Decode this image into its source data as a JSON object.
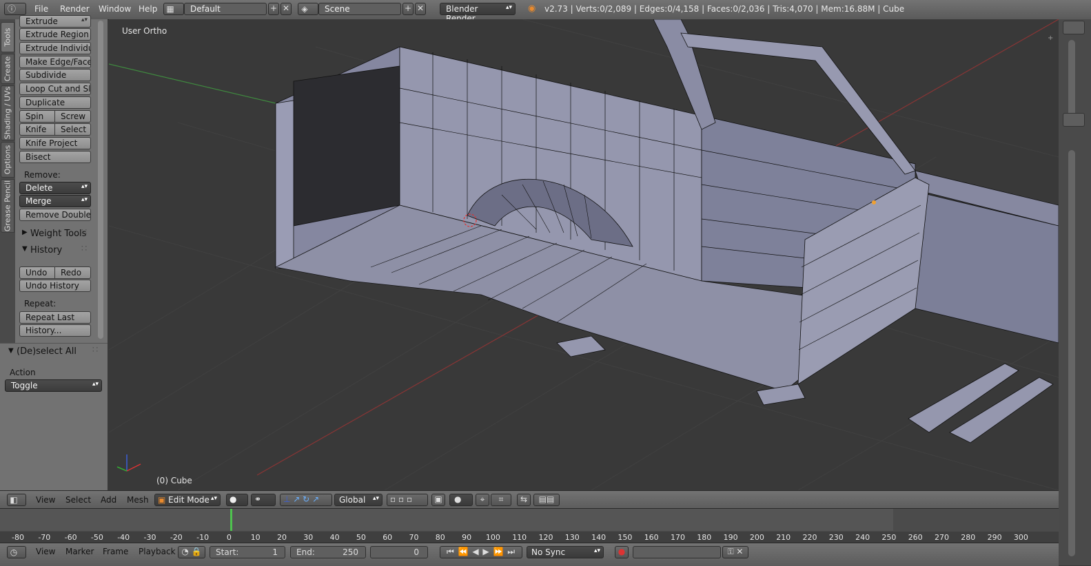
{
  "info_header": {
    "menus": [
      "File",
      "Render",
      "Window",
      "Help"
    ],
    "layout_name": "Default",
    "scene_name": "Scene",
    "render_engine": "Blender Render",
    "stats": "v2.73 | Verts:0/2,089 | Edges:0/4,158 | Faces:0/2,036 | Tris:4,070 | Mem:16.88M | Cube"
  },
  "tabs": [
    "Tools",
    "Create",
    "Shading / UVs",
    "Options",
    "Grease Pencil"
  ],
  "toolshelf": {
    "top_dropdown": "Extrude",
    "buttons": [
      "Extrude Region",
      "Extrude Individual",
      "Make Edge/Face",
      "Subdivide",
      "Loop Cut and Slide",
      "Duplicate"
    ],
    "spin": "Spin",
    "screw": "Screw",
    "knife": "Knife",
    "select": "Select",
    "knife_project": "Knife Project",
    "bisect": "Bisect",
    "remove_label": "Remove:",
    "delete": "Delete",
    "merge": "Merge",
    "remove_doubles": "Remove Doubles",
    "weight_tools": "Weight Tools",
    "history_title": "History",
    "undo": "Undo",
    "redo": "Redo",
    "undo_history": "Undo History",
    "repeat_label": "Repeat:",
    "repeat_last": "Repeat Last",
    "history_btn": "History..."
  },
  "operator": {
    "title": "(De)select All",
    "action_label": "Action",
    "action_value": "Toggle"
  },
  "viewport": {
    "view_name": "User Ortho",
    "object_label": "(0) Cube",
    "bg_color": "#393939",
    "mesh_color": "#8e90a6"
  },
  "view_header": {
    "menus": [
      "View",
      "Select",
      "Add",
      "Mesh"
    ],
    "mode": "Edit Mode",
    "orientation": "Global"
  },
  "timeline": {
    "ticks": [
      "-80",
      "-70",
      "-60",
      "-50",
      "-40",
      "-30",
      "-20",
      "-10",
      "0",
      "10",
      "20",
      "30",
      "40",
      "50",
      "60",
      "70",
      "80",
      "90",
      "100",
      "110",
      "120",
      "130",
      "140",
      "150",
      "160",
      "170",
      "180",
      "190",
      "200",
      "210",
      "220",
      "230",
      "240",
      "250",
      "260",
      "270",
      "280",
      "290",
      "300"
    ],
    "current_frame_marker": 0
  },
  "bottom_header": {
    "menus": [
      "View",
      "Marker",
      "Frame",
      "Playback"
    ],
    "start_label": "Start:",
    "start_value": "1",
    "end_label": "End:",
    "end_value": "250",
    "current_frame": "0",
    "sync": "No Sync"
  }
}
